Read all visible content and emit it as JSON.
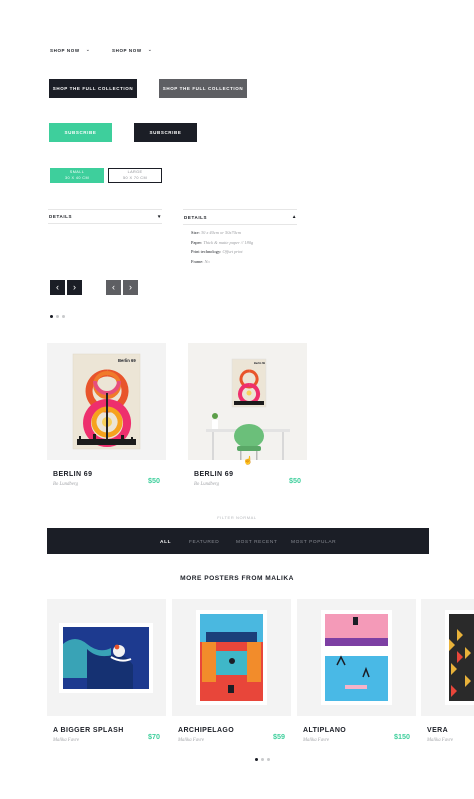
{
  "shop_links": [
    {
      "label": "SHOP NOW"
    },
    {
      "label": "SHOP NOW"
    }
  ],
  "collection_buttons": [
    {
      "label": "SHOP THE FULL COLLECTION"
    },
    {
      "label": "SHOP THE FULL COLLECTION"
    }
  ],
  "subscribe_buttons": [
    {
      "label": "SUBSCRIBE"
    },
    {
      "label": "SUBSCRIBE"
    }
  ],
  "size_options": [
    {
      "name": "SMALL",
      "dims": "30 X 40 CM",
      "selected": true
    },
    {
      "name": "LARGE",
      "dims": "50 X 70 CM",
      "selected": false
    }
  ],
  "details": {
    "collapsed_label": "DETAILS",
    "expanded_label": "DETAILS",
    "rows": [
      {
        "key": "Size:",
        "value": "30 x 40cm  or  50x70cm"
      },
      {
        "key": "Paper:",
        "value": "Thick & matte paper // 180g"
      },
      {
        "key": "Print technology:",
        "value": "Offset print"
      },
      {
        "key": "Frame:",
        "value": "No"
      }
    ]
  },
  "products": [
    {
      "title": "BERLIN 69",
      "author": "Bo Lundberg",
      "price": "$50",
      "poster_label": "Berlin 69"
    },
    {
      "title": "BERLIN 69",
      "author": "Bo Lundberg",
      "price": "$50",
      "poster_label": "Berlin 69"
    }
  ],
  "filter": {
    "caption": "FILTER NORMAL",
    "tabs": [
      "ALL",
      "FEATURED",
      "MOST RECENT",
      "MOST POPULAR"
    ],
    "active": "ALL"
  },
  "more_section": {
    "title": "MORE POSTERS FROM MALIKA",
    "items": [
      {
        "title": "A BIGGER SPLASH",
        "author": "Malika Favre",
        "price": "$70"
      },
      {
        "title": "ARCHIPELAGO",
        "author": "Malika Favre",
        "price": "$59"
      },
      {
        "title": "ALTIPLANO",
        "author": "Malika Favre",
        "price": "$150"
      },
      {
        "title": "VERA",
        "author": "Malika Favre",
        "price": ""
      }
    ]
  },
  "colors": {
    "accent": "#3ecf9c",
    "dark": "#1b1e26",
    "grey_button": "#5e5f63"
  },
  "icons": {
    "chevron": "chevron-down-icon",
    "arrows": [
      "arrow-left-icon",
      "arrow-right-icon"
    ]
  }
}
